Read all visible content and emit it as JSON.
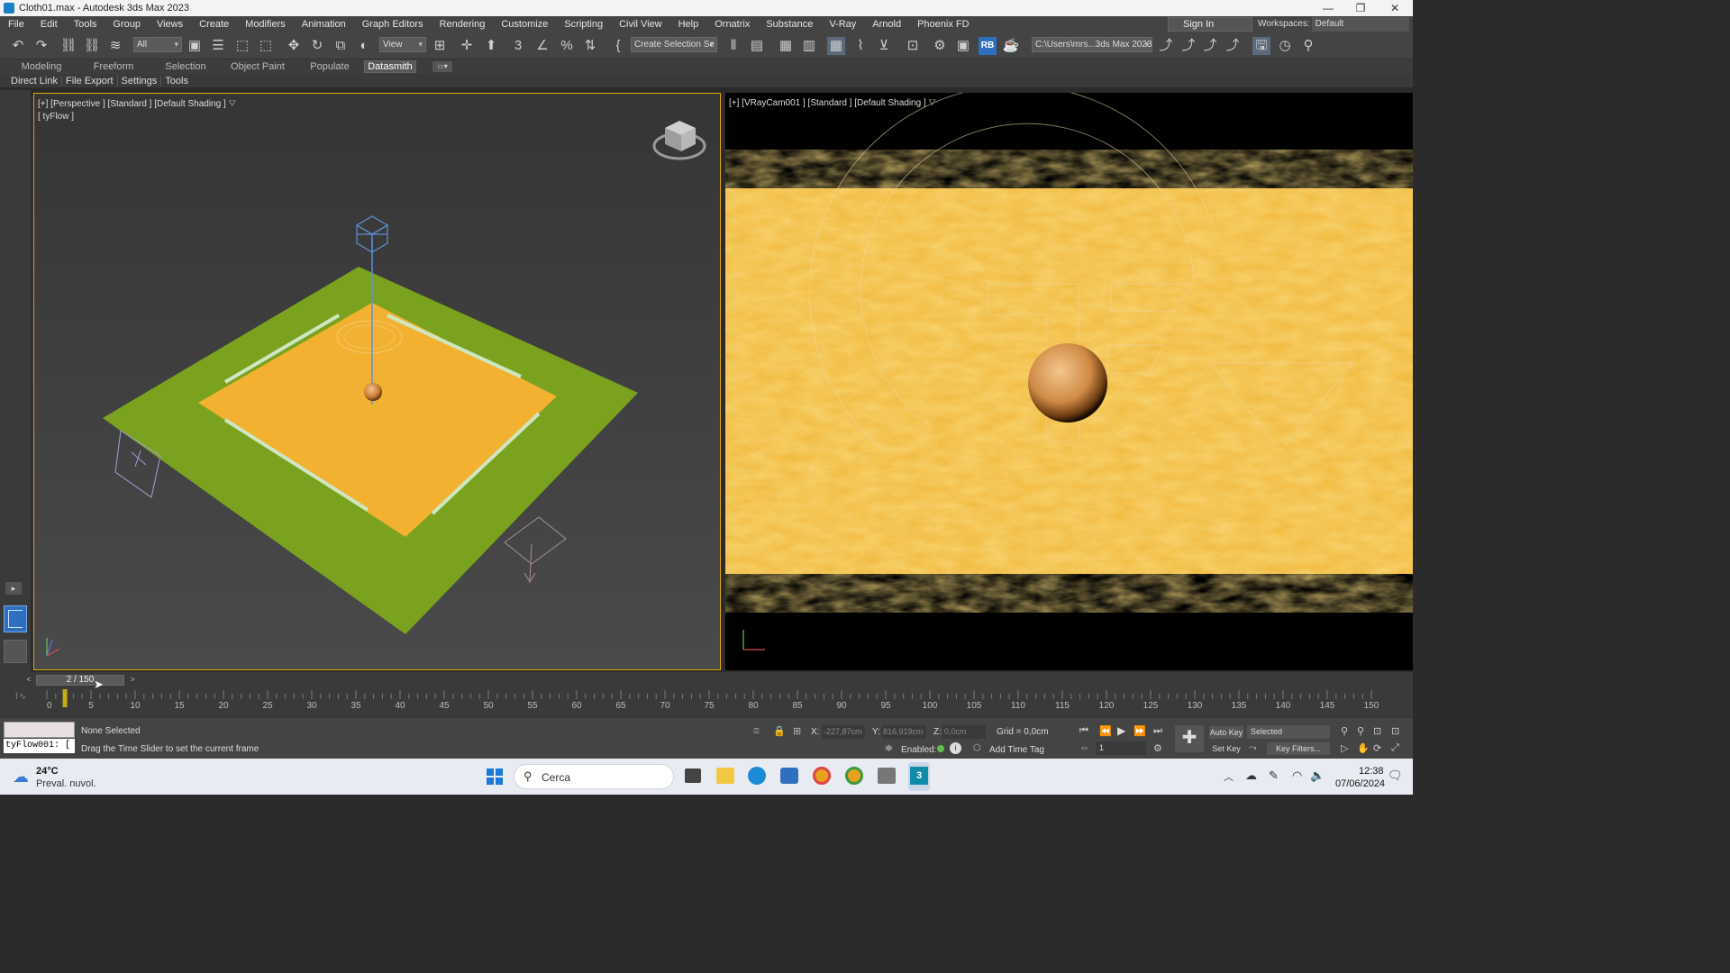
{
  "window": {
    "title": "Cloth01.max - Autodesk 3ds Max 2023"
  },
  "menu": [
    "File",
    "Edit",
    "Tools",
    "Group",
    "Views",
    "Create",
    "Modifiers",
    "Animation",
    "Graph Editors",
    "Rendering",
    "Customize",
    "Scripting",
    "Civil View",
    "Help",
    "Ornatrix",
    "Substance",
    "V-Ray",
    "Arnold",
    "Phoenix FD"
  ],
  "account": {
    "signin": "Sign In",
    "workspaces_label": "Workspaces:",
    "workspace_value": "Default"
  },
  "toolbar": {
    "filter_select": "All",
    "refcoord_select": "View",
    "named_selection": "Create Selection Se",
    "project_path": "C:\\Users\\mrs...3ds Max 2023"
  },
  "ribbon_tabs": [
    "Modeling",
    "Freeform",
    "Selection",
    "Object Paint",
    "Populate",
    "Datasmith"
  ],
  "ribbon_active": "Datasmith",
  "datasmith_buttons": [
    "Direct Link",
    "File Export",
    "Settings",
    "Tools"
  ],
  "viewport_left": {
    "label": "[+] [Perspective ] [Standard ] [Default Shading ]",
    "sublabel": "[ tyFlow ]"
  },
  "viewport_right": {
    "label": "[+] [VRayCam001 ] [Standard ] [Default Shading ]"
  },
  "timeline": {
    "slider_label": "2 / 150",
    "current_frame": 2,
    "frame_end": 150,
    "ticks": [
      0,
      5,
      10,
      15,
      20,
      25,
      30,
      35,
      40,
      45,
      50,
      55,
      60,
      65,
      70,
      75,
      80,
      85,
      90,
      95,
      100,
      105,
      110,
      115,
      120,
      125,
      130,
      135,
      140,
      145,
      150
    ]
  },
  "status": {
    "script_listener": "tyFlow001: [",
    "selection": "None Selected",
    "prompt": "Drag the Time Slider to set the current frame",
    "x_label": "X:",
    "x_value": "-227,87cm",
    "y_label": "Y:",
    "y_value": "816,919cm",
    "z_label": "Z:",
    "z_value": "0,0cm",
    "grid": "Grid = 0,0cm",
    "enabled_label": "Enabled:",
    "add_time_tag": "Add Time Tag",
    "auto_key": "Auto Key",
    "set_key": "Set Key",
    "selected_select": "Selected",
    "key_filters": "Key Filters...",
    "frame_field": "1"
  },
  "taskbar": {
    "weather_temp": "24°C",
    "weather_desc": "Preval. nuvol.",
    "search_placeholder": "Cerca",
    "time": "12:38",
    "date": "07/06/2024"
  },
  "colors": {
    "accent_yellow": "#e0a800",
    "cloth": "#f2b130",
    "ground": "#7aa21e",
    "sphere": "#d98c3f"
  }
}
